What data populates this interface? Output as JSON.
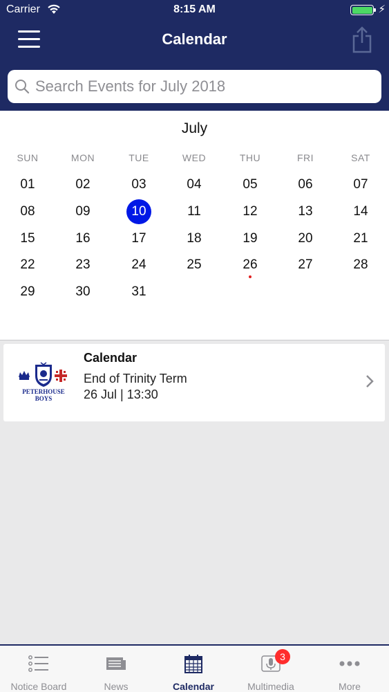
{
  "status_bar": {
    "carrier": "Carrier",
    "time": "8:15 AM",
    "battery_level": 1.0
  },
  "nav": {
    "title": "Calendar"
  },
  "search": {
    "placeholder": "Search Events for July 2018",
    "value": ""
  },
  "calendar": {
    "month": "July",
    "weekdays": [
      "SUN",
      "MON",
      "TUE",
      "WED",
      "THU",
      "FRI",
      "SAT"
    ],
    "weeks": [
      [
        "01",
        "02",
        "03",
        "04",
        "05",
        "06",
        "07"
      ],
      [
        "08",
        "09",
        "10",
        "11",
        "12",
        "13",
        "14"
      ],
      [
        "15",
        "16",
        "17",
        "18",
        "19",
        "20",
        "21"
      ],
      [
        "22",
        "23",
        "24",
        "25",
        "26",
        "27",
        "28"
      ],
      [
        "29",
        "30",
        "31",
        "",
        "",
        "",
        ""
      ]
    ],
    "selected_day": "10",
    "event_days": [
      "26"
    ],
    "selected_color": "#0018e6",
    "event_dot_color": "#e02020"
  },
  "event": {
    "heading": "Calendar",
    "title": "End of Trinity Term",
    "datetime": "26 Jul | 13:30",
    "logo_text_1": "PETERHOUSE",
    "logo_text_2": "BOYS"
  },
  "tabbar": {
    "tabs": [
      {
        "label": "Notice Board",
        "icon": "list-icon"
      },
      {
        "label": "News",
        "icon": "newspaper-icon"
      },
      {
        "label": "Calendar",
        "icon": "calendar-icon",
        "active": true
      },
      {
        "label": "Multimedia",
        "icon": "microphone-icon",
        "badge": "3"
      },
      {
        "label": "More",
        "icon": "more-icon"
      }
    ]
  },
  "colors": {
    "header": "#1e2a63",
    "active_tab": "#1e2a63",
    "badge": "#ff2d2d"
  }
}
